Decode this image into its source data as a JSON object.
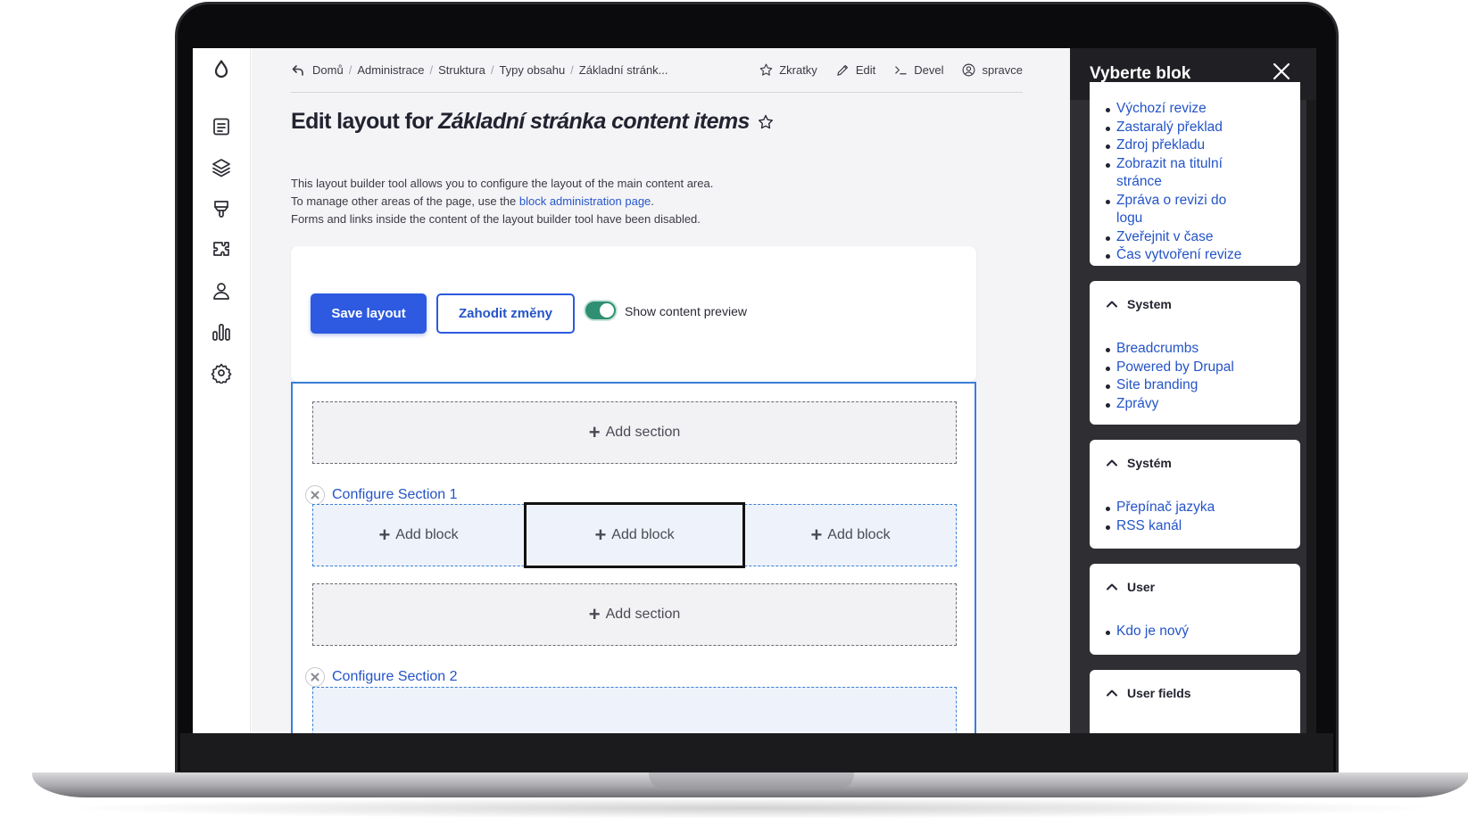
{
  "breadcrumb": [
    "Domů",
    "Administrace",
    "Struktura",
    "Typy obsahu",
    "Základní stránk..."
  ],
  "topnav": {
    "shortcuts": "Zkratky",
    "edit": "Edit",
    "devel": "Devel",
    "user": "spravce"
  },
  "page": {
    "title_prefix": "Edit layout for",
    "title_em": "Základní stránka content items",
    "desc_line1": "This layout builder tool allows you to configure the layout of the main content area.",
    "desc_line2_pre": "To manage other areas of the page, use the",
    "desc_line2_link": "block administration page",
    "desc_line2_post": ".",
    "desc_line3": "Forms and links inside the content of the layout builder tool have been disabled."
  },
  "actions": {
    "save": "Save layout",
    "discard": "Zahodit změny",
    "preview_toggle_label": "Show content preview",
    "preview_on": true
  },
  "builder": {
    "add_section": "Add section",
    "add_block": "Add block",
    "configure_section_1": "Configure Section 1",
    "configure_section_2": "Configure Section 2"
  },
  "offcanvas": {
    "title": "Vyberte blok",
    "top_list": [
      "Výchozí revize",
      "Zastaralý překlad",
      "Zdroj překladu",
      "Zobrazit na titulní stránce",
      "Zpráva o revizi do logu",
      "Zveřejnit v čase",
      "Čas vytvoření revize"
    ],
    "groups": [
      {
        "title": "System",
        "items": [
          "Breadcrumbs",
          "Powered by Drupal",
          "Site branding",
          "Zprávy"
        ]
      },
      {
        "title": "Systém",
        "items": [
          "Přepínač jazyka",
          "RSS kanál"
        ]
      },
      {
        "title": "User",
        "items": [
          "Kdo je nový"
        ]
      },
      {
        "title": "User fields",
        "items": []
      }
    ]
  },
  "icons": {
    "toolbar": [
      "drupal-drop-icon",
      "content-icon",
      "structure-icon",
      "appearance-icon",
      "extend-icon",
      "people-icon",
      "reports-icon",
      "config-icon"
    ]
  },
  "colors": {
    "primary": "#2d5ae0",
    "link": "#2454c7",
    "toggle_on": "#2f8f72",
    "builder_outline": "#3a7fd5",
    "offcanvas_bg": "#2e2e33"
  }
}
